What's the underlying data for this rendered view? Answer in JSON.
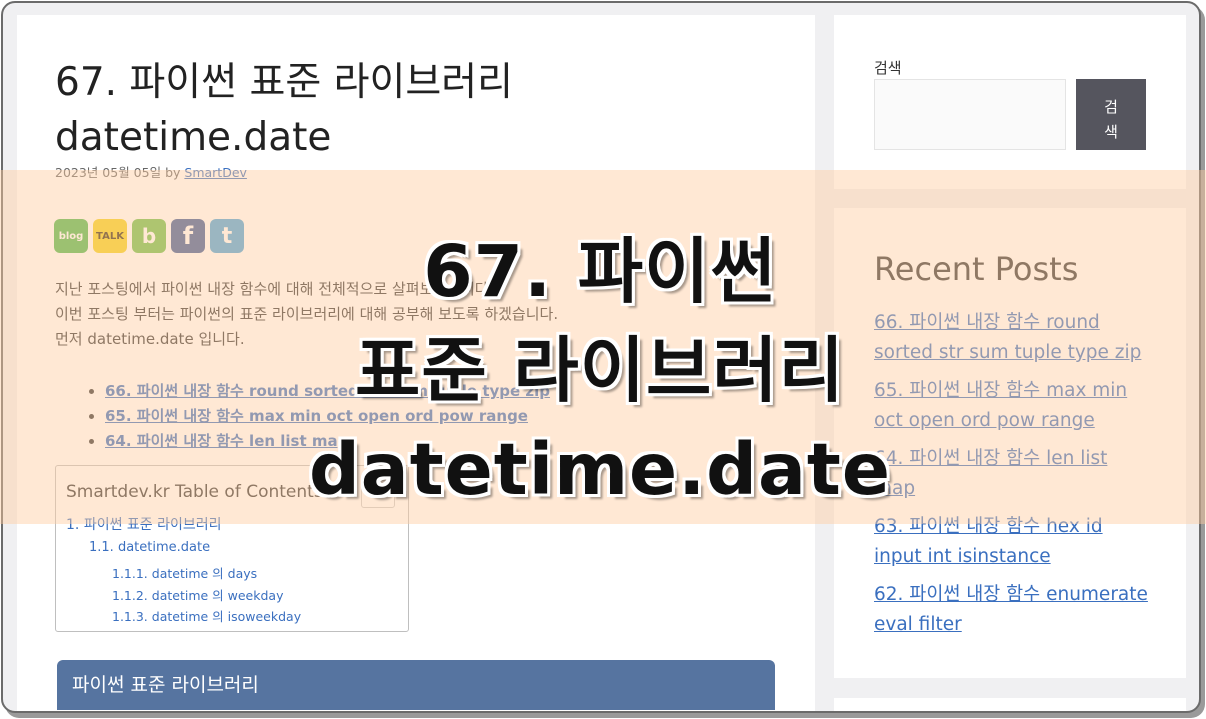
{
  "post": {
    "title_line1": "67. 파이썬 표준 라이브러리",
    "title_line2": "datetime.date",
    "date": "2023년 05월 05일",
    "by": "by",
    "author": "SmartDev",
    "intro": [
      "지난 포스팅에서 파이썬 내장 함수에 대해 전체적으로 살펴보았습니다.",
      "이번 포스팅 부터는 파이썬의 표준 라이브러리에 대해 공부해 보도록 하겠습니다.",
      "먼저 datetime.date 입니다."
    ],
    "related": [
      "66. 파이썬 내장 함수 round sorted str sum tuple type zip",
      "65. 파이썬 내장 함수 max min oct open ord pow range",
      "64. 파이썬 내장 함수 len list map"
    ],
    "section_heading": "파이썬 표준 라이브러리"
  },
  "share": {
    "icons": [
      "blog-icon",
      "kakaotalk-icon",
      "band-icon",
      "facebook-icon",
      "twitter-icon"
    ],
    "blog_label": "blog",
    "talk_label": "TALK",
    "band_label": "b",
    "fb_label": "f",
    "tw_label": "t"
  },
  "toc": {
    "title": "Smartdev.kr Table of Contents",
    "toggle_symbol": "☰",
    "items": [
      {
        "num": "1.",
        "text": "파이썬 표준 라이브러리"
      },
      {
        "num": "1.1.",
        "text": "datetime.date"
      },
      {
        "num": "1.1.1.",
        "text": "datetime 의 days"
      },
      {
        "num": "1.1.2.",
        "text": "datetime 의 weekday"
      },
      {
        "num": "1.1.3.",
        "text": "datetime 의 isoweekday"
      }
    ]
  },
  "sidebar": {
    "search_label": "검색",
    "search_button": "검\n색",
    "recent_title": "Recent Posts",
    "recent_posts": [
      "66. 파이썬 내장 함수 round sorted str sum tuple type zip",
      "65. 파이썬 내장 함수 max min oct open ord pow range",
      "64. 파이썬 내장 함수 len list map",
      "63. 파이썬 내장 함수 hex id input int isinstance",
      "62. 파이썬 내장 함수 enumerate eval filter"
    ]
  },
  "overlay": {
    "line1": "67. 파이썬",
    "line2": "표준 라이브러리",
    "line3": "datetime.date"
  },
  "colors": {
    "link": "#3a6fbf",
    "section_bar": "#5674a0",
    "search_button": "#55555e",
    "band": "#ffcda0"
  }
}
